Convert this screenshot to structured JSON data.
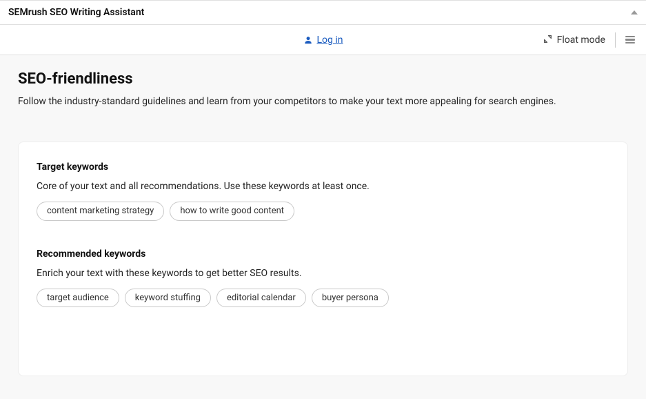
{
  "header": {
    "title": "SEMrush SEO Writing Assistant"
  },
  "toolbar": {
    "login_label": "Log in",
    "float_label": "Float mode"
  },
  "page": {
    "title": "SEO-friendliness",
    "description": "Follow the industry-standard guidelines and learn from your competitors to make your text more appealing for search engines."
  },
  "sections": {
    "target": {
      "title": "Target keywords",
      "description": "Core of your text and all recommendations. Use these keywords at least once.",
      "keywords": [
        "content marketing strategy",
        "how to write good content"
      ]
    },
    "recommended": {
      "title": "Recommended keywords",
      "description": "Enrich your text with these keywords to get better SEO results.",
      "keywords": [
        "target audience",
        "keyword stuffing",
        "editorial calendar",
        "buyer persona"
      ]
    }
  }
}
